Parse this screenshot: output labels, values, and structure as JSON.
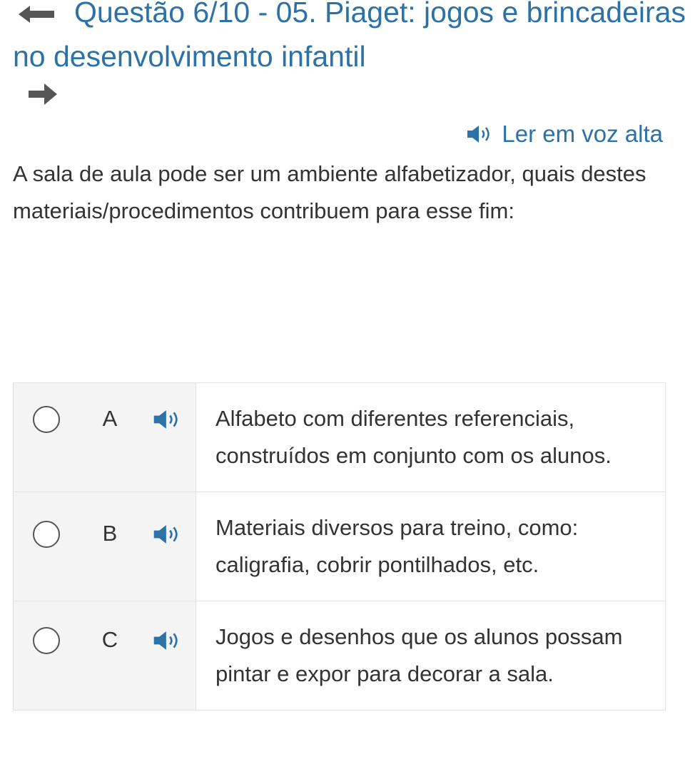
{
  "header": {
    "title": "Questão 6/10 - 05. Piaget: jogos e brincadeiras no desenvolvimento infantil",
    "back_icon": "arrow-left-icon",
    "next_icon": "arrow-right-icon"
  },
  "read_aloud": {
    "label": "Ler em voz alta",
    "icon": "speaker-icon"
  },
  "question": {
    "text": "A sala de aula pode ser um ambiente alfabetizador, quais destes materiais/procedimentos contribuem para esse fim:"
  },
  "options": [
    {
      "letter": "A",
      "text": "Alfabeto com diferentes referenciais, construídos em conjunto com os alunos.",
      "selected": false
    },
    {
      "letter": "B",
      "text": "Materiais diversos para treino, como: caligrafia, cobrir pontilhados, etc.",
      "selected": false
    },
    {
      "letter": "C",
      "text": "Jogos e desenhos que os alunos possam pintar e expor para decorar a sala.",
      "selected": false
    }
  ],
  "colors": {
    "accent": "#2d72a7",
    "text": "#333333",
    "option_bg": "#f4f4f4",
    "border": "#e3e3e3"
  }
}
